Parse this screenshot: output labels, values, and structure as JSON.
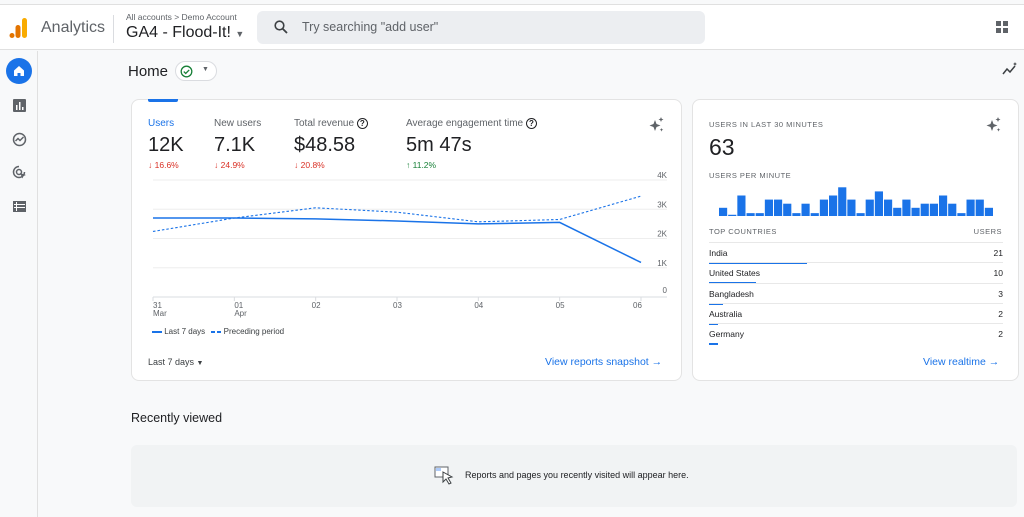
{
  "header": {
    "app_name": "Analytics",
    "breadcrumb": "All accounts > Demo Account",
    "property": "GA4 - Flood-It!",
    "search_placeholder": "Try searching \"add user\""
  },
  "sidebar": {
    "items": [
      {
        "name": "home",
        "icon": "home-icon",
        "active": true
      },
      {
        "name": "reports",
        "icon": "bar-chart-icon"
      },
      {
        "name": "explore",
        "icon": "explore-icon"
      },
      {
        "name": "advertising",
        "icon": "target-cursor-icon"
      },
      {
        "name": "configure",
        "icon": "table-list-icon"
      }
    ]
  },
  "page": {
    "title": "Home",
    "status_icon": "check-circle-icon"
  },
  "overview": {
    "metrics": [
      {
        "label": "Users",
        "value": "12K",
        "change": "16.6%",
        "direction": "down"
      },
      {
        "label": "New users",
        "value": "7.1K",
        "change": "24.9%",
        "direction": "down"
      },
      {
        "label": "Total revenue",
        "value": "$48.58",
        "change": "20.8%",
        "direction": "down"
      },
      {
        "label": "Average engagement time",
        "value": "5m 47s",
        "change": "11.2%",
        "direction": "up"
      }
    ],
    "date_range": "Last 7 days",
    "link": "View reports snapshot"
  },
  "chart_data": [
    {
      "type": "line",
      "x": [
        "31 Mar",
        "01 Apr",
        "02",
        "03",
        "04",
        "05",
        "06"
      ],
      "x_tick_labels": [
        [
          "31",
          "Mar"
        ],
        [
          "01",
          "Apr"
        ],
        [
          "02",
          ""
        ],
        [
          "03",
          ""
        ],
        [
          "04",
          ""
        ],
        [
          "05",
          ""
        ],
        [
          "06",
          ""
        ]
      ],
      "y_tick_labels": [
        "4K",
        "3K",
        "2K",
        "1K",
        "0"
      ],
      "ylim": [
        0,
        4000
      ],
      "grid": true,
      "legend": "bottom-left",
      "series": [
        {
          "name": "Last 7 days",
          "style": "solid",
          "color": "#1a73e8",
          "values": [
            2700,
            2700,
            2670,
            2600,
            2500,
            2550,
            1180
          ]
        },
        {
          "name": "Preceding period",
          "style": "dashed",
          "color": "#1a73e8",
          "values": [
            2240,
            2700,
            3050,
            2900,
            2570,
            2650,
            3450
          ]
        }
      ]
    },
    {
      "type": "bar",
      "title": "USERS PER MINUTE",
      "color": "#1a73e8",
      "values": [
        2,
        0.3,
        5,
        0.7,
        0.7,
        4,
        4,
        3,
        0.7,
        3,
        0.7,
        4,
        5,
        7,
        4,
        0.7,
        4,
        6,
        4,
        2,
        4,
        2,
        3,
        3,
        5,
        3,
        0.7,
        4,
        4,
        2
      ]
    }
  ],
  "realtime": {
    "title": "USERS IN LAST 30 MINUTES",
    "value": "63",
    "per_minute_label": "USERS PER MINUTE",
    "countries_header": "TOP COUNTRIES",
    "users_header": "USERS",
    "countries": [
      {
        "name": "India",
        "users": "21"
      },
      {
        "name": "United States",
        "users": "10"
      },
      {
        "name": "Bangladesh",
        "users": "3"
      },
      {
        "name": "Australia",
        "users": "2"
      },
      {
        "name": "Germany",
        "users": "2"
      }
    ],
    "link": "View realtime"
  },
  "recent": {
    "title": "Recently viewed",
    "empty_message": "Reports and pages you recently visited will appear here."
  },
  "colors": {
    "accent": "#1a73e8",
    "down": "#d93025",
    "up": "#188038"
  }
}
